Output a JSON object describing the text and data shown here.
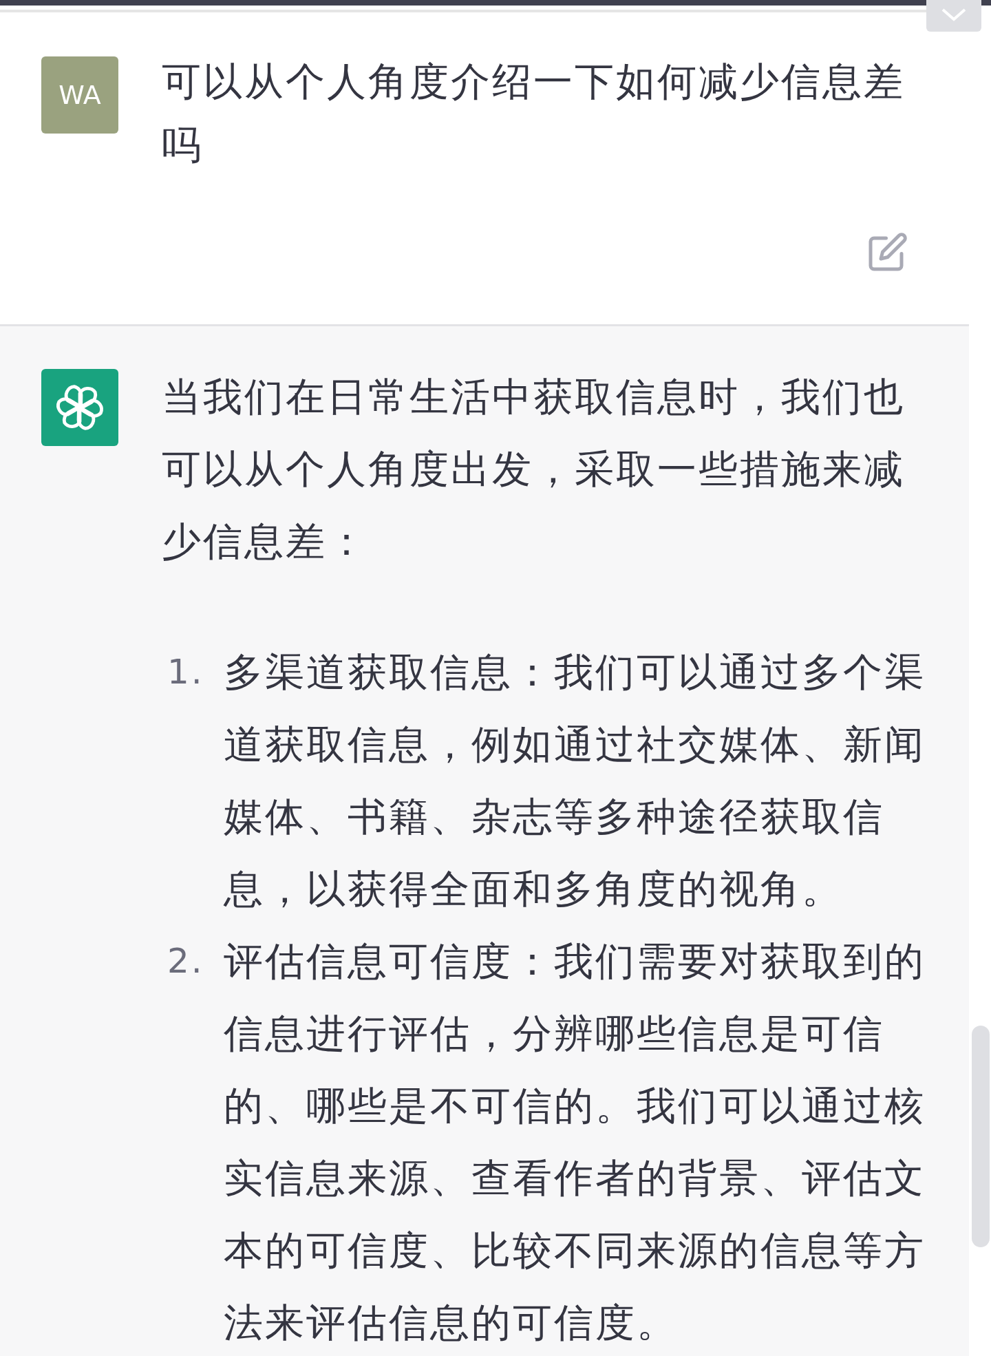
{
  "user_message": {
    "avatar": "WA",
    "text": "可以从个人角度介绍一下如何减少信息差吗"
  },
  "assistant_message": {
    "intro": "当我们在日常生活中获取信息时，我们也可以从个人角度出发，采取一些措施来减少信息差：",
    "items": [
      {
        "number": "1.",
        "text": "多渠道获取信息：我们可以通过多个渠道获取信息，例如通过社交媒体、新闻媒体、书籍、杂志等多种途径获取信息，以获得全面和多角度的视角。"
      },
      {
        "number": "2.",
        "text": "评估信息可信度：我们需要对获取到的信息进行评估，分辨哪些信息是可信的、哪些是不可信的。我们可以通过核实信息来源、查看作者的背景、评估文本的可信度、比较不同来源的信息等方法来评估信息的可信度。"
      }
    ]
  }
}
